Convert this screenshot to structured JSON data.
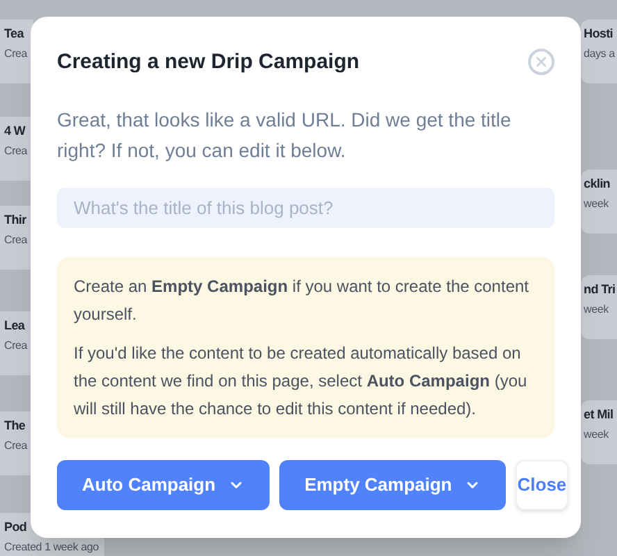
{
  "background_cards": {
    "left": [
      {
        "title": "Tea",
        "subtitle": "Crea"
      },
      {
        "title": "4 W",
        "subtitle": "Crea"
      },
      {
        "title": "Thir",
        "subtitle": "Crea"
      },
      {
        "title": "Lea",
        "subtitle": "Crea"
      },
      {
        "title": "The",
        "subtitle": "Crea"
      },
      {
        "title": "Pod",
        "subtitle": "Created 1 week ago"
      }
    ],
    "right": [
      {
        "title": "Hosti",
        "subtitle": "days a"
      },
      {
        "title": "cklin",
        "subtitle": "week"
      },
      {
        "title": "nd Tri",
        "subtitle": "week"
      },
      {
        "title": "et Mil",
        "subtitle": "week"
      }
    ]
  },
  "dialog": {
    "title": "Creating a new Drip Campaign",
    "intro": "Great, that looks like a valid URL. Did we get the title right? If not, you can edit it below.",
    "title_field": {
      "placeholder": "What's the title of this blog post?"
    },
    "notice": [
      "Create an **Empty Campaign** if you want to create the content yourself.",
      "If you'd like the content to be created automatically based on the content we find on this page, select **Auto Campaign** (you will still have the chance to edit this content if needed)."
    ],
    "buttons": [
      {
        "label": "Auto Campaign",
        "kind": "dropdown"
      },
      {
        "label": "Empty Campaign",
        "kind": "dropdown"
      },
      {
        "label": "Close",
        "kind": "plain"
      }
    ]
  }
}
